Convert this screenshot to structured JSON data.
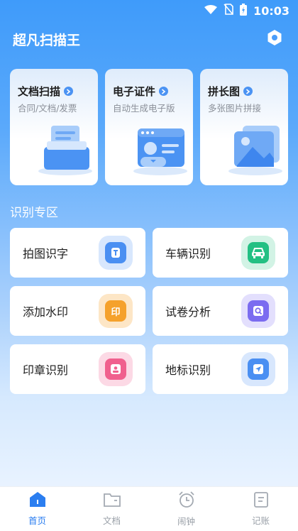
{
  "status_bar": {
    "time": "10:03",
    "icons": [
      "wifi-icon",
      "no-sim-icon",
      "battery-charging-icon"
    ]
  },
  "header": {
    "title": "超凡扫描王",
    "settings_icon": "gear-icon"
  },
  "features": [
    {
      "title": "文档扫描",
      "subtitle": "合同/文档/发票",
      "icon": "document-stack-icon"
    },
    {
      "title": "电子证件",
      "subtitle": "自动生成电子版",
      "icon": "id-card-icon"
    },
    {
      "title": "拼长图",
      "subtitle": "多张图片拼接",
      "icon": "image-stack-icon"
    }
  ],
  "section_title": "识别专区",
  "tools": [
    {
      "label": "拍图识字",
      "icon": "text-recognition-icon",
      "color": "#4a8ff2",
      "glyph": "T"
    },
    {
      "label": "车辆识别",
      "icon": "car-icon",
      "color": "#23c083",
      "glyph": ""
    },
    {
      "label": "添加水印",
      "icon": "watermark-icon",
      "color": "#f5a12b",
      "glyph": "印"
    },
    {
      "label": "试卷分析",
      "icon": "exam-search-icon",
      "color": "#7b6cf0",
      "glyph": ""
    },
    {
      "label": "印章识别",
      "icon": "stamp-icon",
      "color": "#f0608e",
      "glyph": ""
    },
    {
      "label": "地标识别",
      "icon": "landmark-navigation-icon",
      "color": "#4a8ff2",
      "glyph": ""
    }
  ],
  "tabs": [
    {
      "label": "首页",
      "icon": "home-icon",
      "active": true
    },
    {
      "label": "文档",
      "icon": "folder-icon",
      "active": false
    },
    {
      "label": "闹钟",
      "icon": "alarm-clock-icon",
      "active": false
    },
    {
      "label": "记账",
      "icon": "ledger-icon",
      "active": false
    }
  ],
  "colors": {
    "accent": "#2b7ef0",
    "header_gradient_top": "#3f9bfa"
  }
}
